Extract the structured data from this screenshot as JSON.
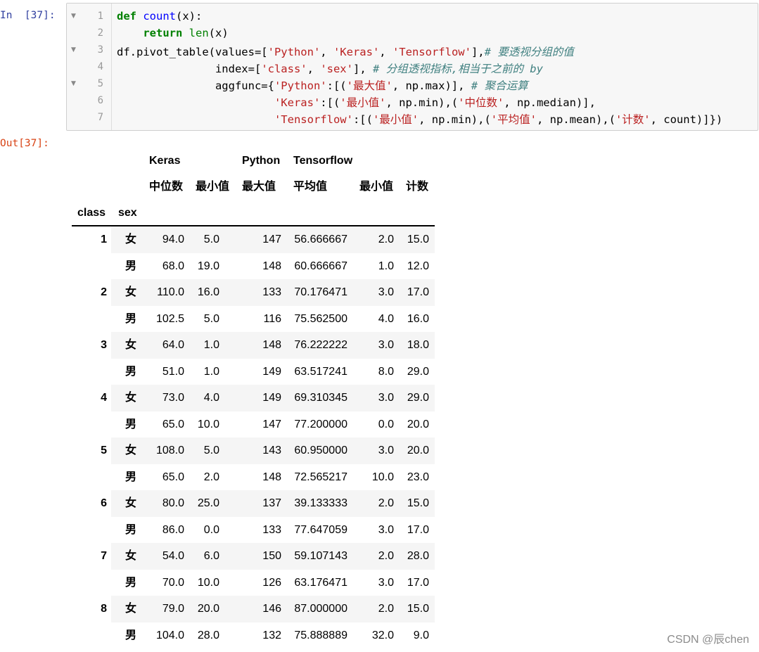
{
  "input_prompt": "In  [37]:",
  "output_prompt": "Out[37]:",
  "code": {
    "line_numbers": [
      "1",
      "2",
      "3",
      "4",
      "5",
      "6",
      "7"
    ],
    "l1": [
      "def",
      " ",
      "count",
      "(x):"
    ],
    "l2": [
      "    ",
      "return",
      " ",
      "len",
      "(x)"
    ],
    "l3": [
      "df.pivot_table(values=[",
      "'Python'",
      ", ",
      "'Keras'",
      ", ",
      "'Tensorflow'",
      "],",
      "# 要透视分组的值"
    ],
    "l4": [
      "               index=[",
      "'class'",
      ", ",
      "'sex'",
      "], ",
      "# 分组透视指标,相当于之前的 by"
    ],
    "l5": [
      "               aggfunc={",
      "'Python'",
      ":[(",
      "'最大值'",
      ", np.max)], ",
      "# 聚合运算"
    ],
    "l6": [
      "                        ",
      "'Keras'",
      ":[(",
      "'最小值'",
      ", np.min),(",
      "'中位数'",
      ", np.median)],"
    ],
    "l7": [
      "                        ",
      "'Tensorflow'",
      ":[(",
      "'最小值'",
      ", np.min),(",
      "'平均值'",
      ", np.mean),(",
      "'计数'",
      ", count)]})"
    ]
  },
  "table": {
    "top_headers": [
      "Keras",
      "Python",
      "Tensorflow"
    ],
    "sub_headers": [
      "中位数",
      "最小值",
      "最大值",
      "平均值",
      "最小值",
      "计数"
    ],
    "index_names": [
      "class",
      "sex"
    ],
    "groups": [
      {
        "class": "1",
        "rows": [
          {
            "sex": "女",
            "values": [
              "94.0",
              "5.0",
              "147",
              "56.666667",
              "2.0",
              "15.0"
            ]
          },
          {
            "sex": "男",
            "values": [
              "68.0",
              "19.0",
              "148",
              "60.666667",
              "1.0",
              "12.0"
            ]
          }
        ]
      },
      {
        "class": "2",
        "rows": [
          {
            "sex": "女",
            "values": [
              "110.0",
              "16.0",
              "133",
              "70.176471",
              "3.0",
              "17.0"
            ]
          },
          {
            "sex": "男",
            "values": [
              "102.5",
              "5.0",
              "116",
              "75.562500",
              "4.0",
              "16.0"
            ]
          }
        ]
      },
      {
        "class": "3",
        "rows": [
          {
            "sex": "女",
            "values": [
              "64.0",
              "1.0",
              "148",
              "76.222222",
              "3.0",
              "18.0"
            ]
          },
          {
            "sex": "男",
            "values": [
              "51.0",
              "1.0",
              "149",
              "63.517241",
              "8.0",
              "29.0"
            ]
          }
        ]
      },
      {
        "class": "4",
        "rows": [
          {
            "sex": "女",
            "values": [
              "73.0",
              "4.0",
              "149",
              "69.310345",
              "3.0",
              "29.0"
            ]
          },
          {
            "sex": "男",
            "values": [
              "65.0",
              "10.0",
              "147",
              "77.200000",
              "0.0",
              "20.0"
            ]
          }
        ]
      },
      {
        "class": "5",
        "rows": [
          {
            "sex": "女",
            "values": [
              "108.0",
              "5.0",
              "143",
              "60.950000",
              "3.0",
              "20.0"
            ]
          },
          {
            "sex": "男",
            "values": [
              "65.0",
              "2.0",
              "148",
              "72.565217",
              "10.0",
              "23.0"
            ]
          }
        ]
      },
      {
        "class": "6",
        "rows": [
          {
            "sex": "女",
            "values": [
              "80.0",
              "25.0",
              "137",
              "39.133333",
              "2.0",
              "15.0"
            ]
          },
          {
            "sex": "男",
            "values": [
              "86.0",
              "0.0",
              "133",
              "77.647059",
              "3.0",
              "17.0"
            ]
          }
        ]
      },
      {
        "class": "7",
        "rows": [
          {
            "sex": "女",
            "values": [
              "54.0",
              "6.0",
              "150",
              "59.107143",
              "2.0",
              "28.0"
            ]
          },
          {
            "sex": "男",
            "values": [
              "70.0",
              "10.0",
              "126",
              "63.176471",
              "3.0",
              "17.0"
            ]
          }
        ]
      },
      {
        "class": "8",
        "rows": [
          {
            "sex": "女",
            "values": [
              "79.0",
              "20.0",
              "146",
              "87.000000",
              "2.0",
              "15.0"
            ]
          },
          {
            "sex": "男",
            "values": [
              "104.0",
              "28.0",
              "132",
              "75.888889",
              "32.0",
              "9.0"
            ]
          }
        ]
      }
    ]
  },
  "watermark": "CSDN @辰chen"
}
